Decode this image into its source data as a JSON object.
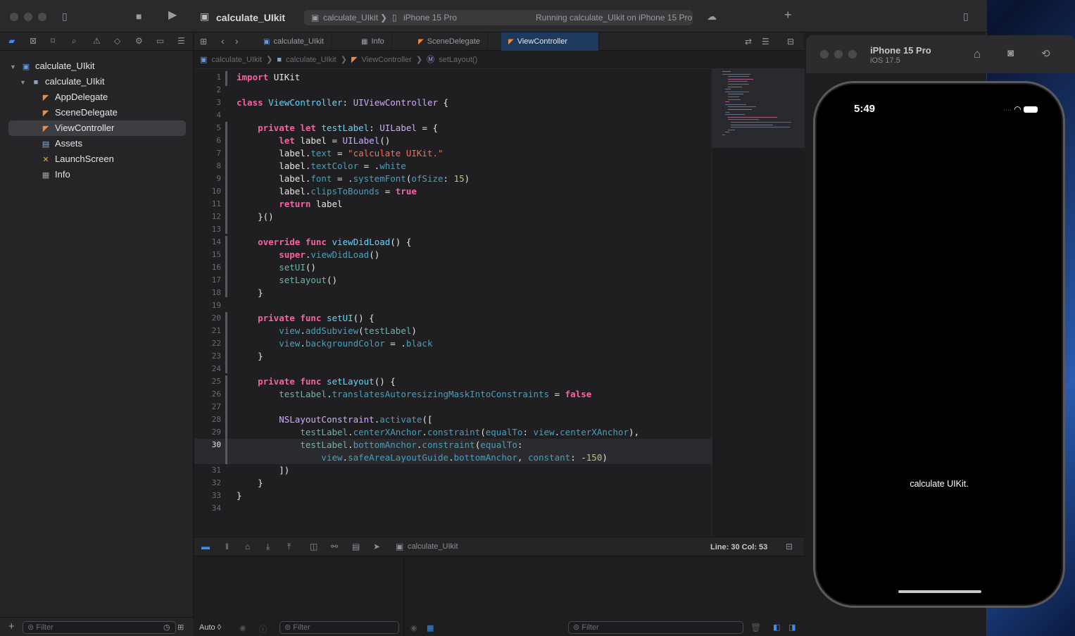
{
  "toolbar": {
    "project_title": "calculate_UIkit",
    "scheme_name": "calculate_UIkit",
    "device": "iPhone 15 Pro",
    "status": "Running calculate_UIkit on iPhone 15 Pro"
  },
  "navigator": {
    "tree": [
      {
        "label": "calculate_UIkit",
        "kind": "project"
      },
      {
        "label": "calculate_UIkit",
        "kind": "folder"
      },
      {
        "label": "AppDelegate",
        "kind": "swift"
      },
      {
        "label": "SceneDelegate",
        "kind": "swift"
      },
      {
        "label": "ViewController",
        "kind": "swift",
        "selected": true
      },
      {
        "label": "Assets",
        "kind": "assets"
      },
      {
        "label": "LaunchScreen",
        "kind": "storyboard"
      },
      {
        "label": "Info",
        "kind": "plist"
      }
    ],
    "filter_placeholder": "Filter"
  },
  "tabs": [
    {
      "label": "calculate_UIkit"
    },
    {
      "label": "Info"
    },
    {
      "label": "SceneDelegate"
    },
    {
      "label": "ViewController",
      "active": true
    }
  ],
  "breadcrumb": [
    "calculate_UIkit",
    "calculate_UIkit",
    "ViewController",
    "setLayout()"
  ],
  "code": {
    "current_line": 30,
    "line_numbers": [
      "1",
      "2",
      "3",
      "4",
      "5",
      "6",
      "7",
      "8",
      "9",
      "10",
      "11",
      "12",
      "13",
      "14",
      "15",
      "16",
      "17",
      "18",
      "19",
      "20",
      "21",
      "22",
      "23",
      "24",
      "25",
      "26",
      "27",
      "28",
      "29",
      "30",
      "31",
      "32",
      "33",
      "34"
    ]
  },
  "debug": {
    "scheme": "calculate_UIkit",
    "cursor_position": "Line: 30  Col: 53",
    "output_mode": "Auto ◊",
    "filter_placeholder": "Filter"
  },
  "simulator": {
    "device_name": "iPhone 15 Pro",
    "os_version": "iOS 17.5",
    "time": "5:49",
    "label_text": "calculate UIKit."
  },
  "colors": {
    "accent": "#3b8cf6",
    "keyword": "#fc5fa3",
    "type": "#5dd8ff",
    "string": "#fc6a5d",
    "number": "#d0bf69"
  }
}
